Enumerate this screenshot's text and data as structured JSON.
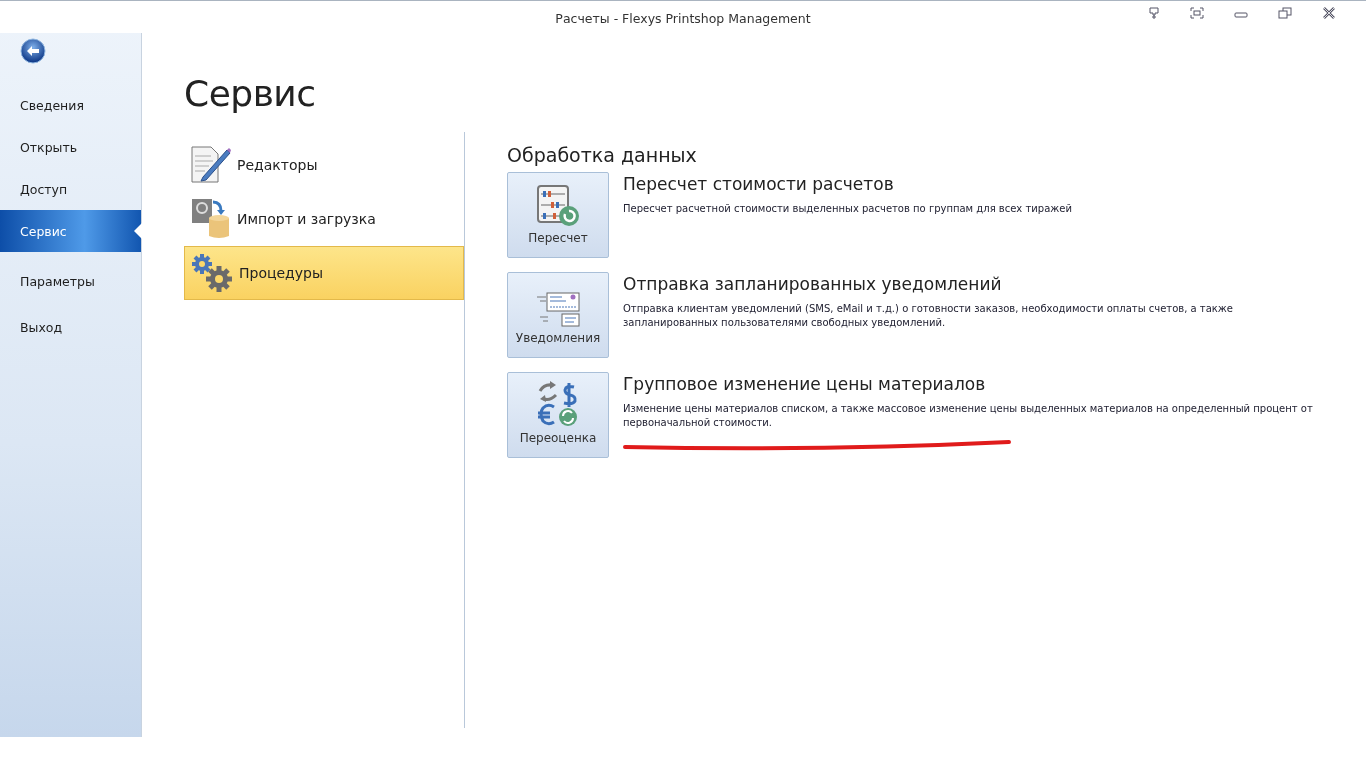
{
  "window": {
    "title": "Расчеты - Flexys Printshop Management"
  },
  "sidebar": {
    "items": [
      {
        "label": "Сведения",
        "selected": false
      },
      {
        "label": "Открыть",
        "selected": false
      },
      {
        "label": "Доступ",
        "selected": false
      },
      {
        "label": "Сервис",
        "selected": true
      },
      {
        "label": "Параметры",
        "selected": false
      },
      {
        "label": "Выход",
        "selected": false
      }
    ]
  },
  "page_title": "Сервис",
  "categories": [
    {
      "label": "Редакторы",
      "kind": "editors",
      "selected": false
    },
    {
      "label": "Импорт и загрузка",
      "kind": "import",
      "selected": false
    },
    {
      "label": "Процедуры",
      "kind": "procedures",
      "selected": true
    }
  ],
  "section_title": "Обработка данных",
  "procedures": [
    {
      "button": "Пересчет",
      "kind": "recalc",
      "title": "Пересчет стоимости расчетов",
      "description": "Пересчет расчетной стоимости выделенных расчетов по группам для всех тиражей",
      "underlined": false
    },
    {
      "button": "Уведомления",
      "kind": "notify",
      "title": "Отправка запланированных уведомлений",
      "description": "Отправка клиентам уведомлений (SMS, eMail и т.д.) о готовности заказов, необходимости оплаты счетов, а также запланированных пользователями свободных уведомлений.",
      "underlined": false
    },
    {
      "button": "Переоценка",
      "kind": "reprice",
      "title": "Групповое изменение цены материалов",
      "description": "Изменение цены материалов списком, а также массовое изменение цены выделенных материалов на определенный процент от первоначальной стоимости.",
      "underlined": true
    }
  ]
}
